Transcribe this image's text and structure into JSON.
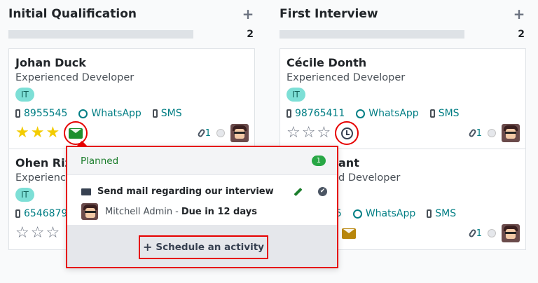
{
  "columns": [
    {
      "title": "Initial Qualification",
      "count": "2",
      "cards": [
        {
          "name": "Johan Duck",
          "job": "Experienced Developer",
          "tag": "IT",
          "phone": "8955545",
          "whatsapp": "WhatsApp",
          "sms": "SMS",
          "stars_filled": 3,
          "activity": "envelope-green",
          "attachments": "1"
        },
        {
          "name": "Ohen Rizo",
          "job": "Experience",
          "tag": "IT",
          "phone": "65468798",
          "stars_filled": 0,
          "activity": "none",
          "attachments": ""
        }
      ]
    },
    {
      "title": "First Interview",
      "count": "2",
      "cards": [
        {
          "name": "Cécile Donth",
          "job": "Experienced Developer",
          "tag": "IT",
          "phone": "98765411",
          "whatsapp": "WhatsApp",
          "sms": "SMS",
          "stars_filled": 0,
          "activity": "clock",
          "attachments": "1"
        },
        {
          "name": "ant",
          "job": "d Developer",
          "tag": "",
          "phone": "15",
          "whatsapp": "WhatsApp",
          "sms": "SMS",
          "stars_filled": 0,
          "activity": "envelope-gold",
          "attachments": "1"
        }
      ]
    }
  ],
  "add_symbol": "+",
  "star_filled_glyph": "★",
  "star_empty_glyph": "☆",
  "popover": {
    "section_label": "Planned",
    "badge": "1",
    "activity_title": "Send mail regarding our interview",
    "assignee": "Mitchell Admin",
    "separator": "-",
    "due": "Due in 12 days",
    "check_glyph": "✔",
    "schedule_plus": "+",
    "schedule_label": "Schedule an activity"
  },
  "colors": {
    "accent_teal": "#017e84",
    "highlight_red": "#e60000",
    "star_gold": "#f3cc00",
    "planned_green": "#1a7d2b",
    "tag_bg": "#7ddfd6"
  }
}
